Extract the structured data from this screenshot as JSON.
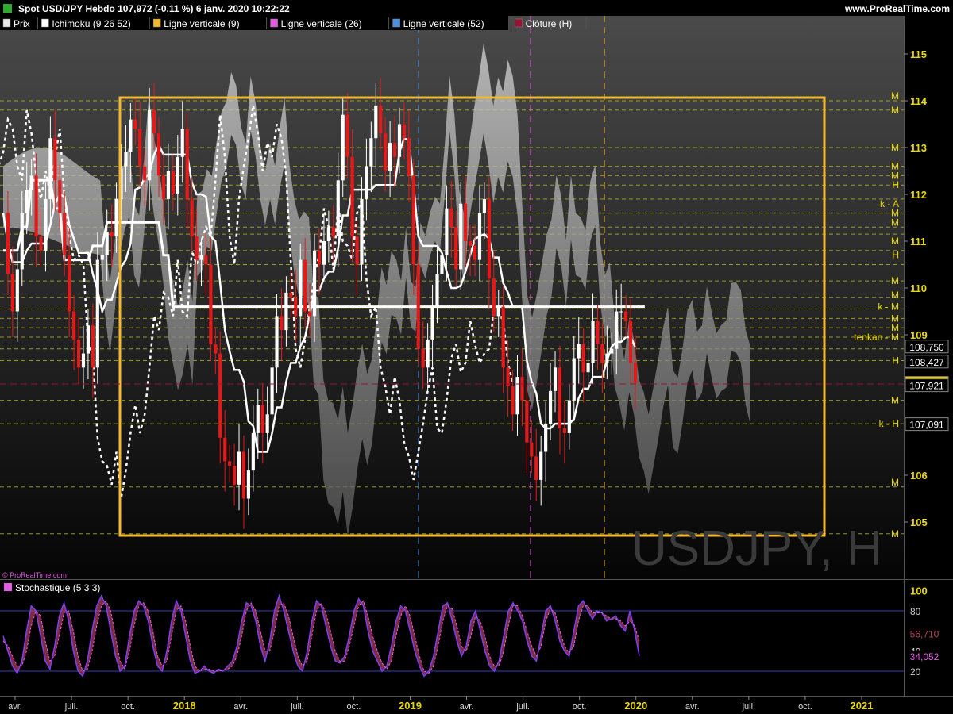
{
  "header": {
    "title": "Spot USD/JPY Hebdo 107,972 (-0,11 %) 6 janv. 2020 10:22:22",
    "site": "www.ProRealTime.com"
  },
  "legend": [
    {
      "label": "Prix",
      "color": "#e8e8e8",
      "icon": "candle-icon"
    },
    {
      "label": "Ichimoku (9 26 52)",
      "color": "#ffffff",
      "icon": "white-square-icon"
    },
    {
      "label": "Ligne verticale (9)",
      "color": "#f5b82e",
      "icon": "yellow-square-icon"
    },
    {
      "label": "Ligne verticale (26)",
      "color": "#e35be0",
      "icon": "magenta-square-icon"
    },
    {
      "label": "Ligne verticale (52)",
      "color": "#4a90e2",
      "icon": "blue-square-icon"
    },
    {
      "label": "Clôture (H)",
      "color": "#9b1030",
      "icon": "crimson-square-icon"
    }
  ],
  "watermark": "USDJPY, H",
  "copyright": "© ProRealTime.com",
  "price_axis": {
    "ticks": [
      "115",
      "114",
      "113",
      "112",
      "111",
      "110",
      "109",
      "108",
      "106",
      "105"
    ],
    "boxes": [
      {
        "label": "108,750",
        "value": 108.75,
        "bg": "#000000",
        "fg": "#ffffff"
      },
      {
        "label": "108,427",
        "value": 108.427,
        "bg": "#000000",
        "fg": "#ffffff"
      },
      {
        "label": "107,972",
        "value": 107.972,
        "bg": "#f5d800",
        "fg": "#000000"
      },
      {
        "label": "107,921",
        "value": 107.921,
        "bg": "#000000",
        "fg": "#ffffff"
      },
      {
        "label": "107,091",
        "value": 107.091,
        "bg": "#000000",
        "fg": "#ffffff"
      }
    ]
  },
  "levels": {
    "values": [
      114.0,
      113.8,
      113.0,
      112.6,
      112.4,
      112.2,
      111.9,
      111.6,
      111.3,
      111.15,
      110.8,
      110.5,
      110.15,
      109.8,
      109.55,
      109.35,
      109.15,
      108.95,
      108.7,
      108.45,
      107.6,
      107.1,
      105.75,
      104.75
    ],
    "markers": [
      {
        "text": "M",
        "value": 114.1
      },
      {
        "text": "M",
        "value": 113.8
      },
      {
        "text": "M",
        "value": 113.0
      },
      {
        "text": "M",
        "value": 112.6
      },
      {
        "text": "M",
        "value": 112.4
      },
      {
        "text": "H",
        "value": 112.2
      },
      {
        "text": "k - A",
        "value": 111.8
      },
      {
        "text": "M",
        "value": 111.6
      },
      {
        "text": "M",
        "value": 111.4
      },
      {
        "text": "M",
        "value": 111.0
      },
      {
        "text": "H",
        "value": 110.7
      },
      {
        "text": "M",
        "value": 110.15
      },
      {
        "text": "M",
        "value": 109.85
      },
      {
        "text": "k - M",
        "value": 109.6
      },
      {
        "text": "M",
        "value": 109.35
      },
      {
        "text": "M",
        "value": 109.15
      },
      {
        "text": "tenkan - M",
        "value": 108.95
      },
      {
        "text": "H",
        "value": 108.45
      },
      {
        "text": "M",
        "value": 107.6
      },
      {
        "text": "k - H",
        "value": 107.1
      },
      {
        "text": "M",
        "value": 105.85
      },
      {
        "text": "M",
        "value": 104.75
      }
    ]
  },
  "time_axis": {
    "labels": [
      {
        "text": "avr.",
        "pos": 0,
        "major": false
      },
      {
        "text": "juil.",
        "pos": 1,
        "major": false
      },
      {
        "text": "oct.",
        "pos": 2,
        "major": false
      },
      {
        "text": "2018",
        "pos": 3,
        "major": true
      },
      {
        "text": "avr.",
        "pos": 4,
        "major": false
      },
      {
        "text": "juil.",
        "pos": 5,
        "major": false
      },
      {
        "text": "oct.",
        "pos": 6,
        "major": false
      },
      {
        "text": "2019",
        "pos": 7,
        "major": true
      },
      {
        "text": "avr.",
        "pos": 8,
        "major": false
      },
      {
        "text": "juil.",
        "pos": 9,
        "major": false
      },
      {
        "text": "oct.",
        "pos": 10,
        "major": false
      },
      {
        "text": "2020",
        "pos": 11,
        "major": true
      },
      {
        "text": "avr.",
        "pos": 12,
        "major": false
      },
      {
        "text": "juil.",
        "pos": 13,
        "major": false
      },
      {
        "text": "oct.",
        "pos": 14,
        "major": false
      },
      {
        "text": "2021",
        "pos": 15,
        "major": true
      }
    ]
  },
  "colors": {
    "background": "#000000",
    "up_candle": "#ffffff",
    "down_candle": "#e81818",
    "level_line": "#b8b820",
    "level_text": "#e8d800",
    "box": "#f5b82e",
    "stoch_k": "#7b3ff5",
    "stoch_d": "#e35be0",
    "stoch_fill": "#b0405a"
  },
  "chart_data": [
    {
      "type": "line",
      "title": "Spot USD/JPY Hebdo",
      "x_unit": "week",
      "ylim": [
        104.0,
        115.6
      ],
      "series": [
        {
          "name": "Prix",
          "values": [
            111.6,
            110.3,
            109.5,
            110.4,
            111.6,
            112.1,
            112.4,
            111.1,
            110.8,
            111.9,
            113.2,
            112.3,
            111.6,
            110.7,
            109.5,
            108.9,
            108.3,
            108.6,
            109.2,
            108.3,
            110.6,
            110.7,
            111.2,
            111.1,
            111.9,
            112.6,
            112.9,
            113.6,
            113.4,
            112.6,
            112.3,
            113.8,
            113.3,
            112.4,
            111.9,
            112.5,
            112.0,
            112.8,
            113.4,
            111.9,
            111.1,
            110.6,
            110.7,
            110.5,
            108.8,
            108.6,
            106.8,
            106.3,
            106.2,
            105.8,
            106.5,
            105.5,
            106.1,
            106.9,
            107.5,
            106.9,
            107.3,
            108.3,
            109.4,
            109.1,
            109.9,
            109.8,
            109.4,
            110.6,
            109.5,
            109.4,
            110.8,
            110.5,
            111.0,
            111.3,
            111.1,
            112.3,
            113.7,
            112.8,
            111.1,
            110.5,
            111.9,
            112.6,
            113.2,
            113.9,
            113.3,
            112.5,
            113.1,
            112.8,
            113.5,
            113.2,
            112.4,
            110.5,
            108.7,
            108.3,
            108.9,
            109.6,
            110.3,
            110.7,
            111.7,
            111.3,
            110.4,
            111.8,
            111.0,
            110.9,
            110.6,
            111.6,
            111.9,
            110.2,
            109.4,
            109.6,
            108.3,
            107.9,
            107.3,
            108.1,
            107.6,
            106.7,
            106.4,
            105.9,
            106.5,
            107.1,
            107.8,
            108.3,
            107.0,
            106.9,
            107.6,
            108.5,
            108.8,
            108.2,
            108.4,
            109.3,
            108.8,
            108.4,
            108.6,
            108.7,
            109.5,
            109.5,
            109.3,
            108.4,
            107.97
          ]
        },
        {
          "name": "Ichimoku (9 26 52)",
          "values": [
            110.8,
            110.8,
            110.8,
            110.8,
            111.3,
            111.3,
            112.3,
            112.3,
            112.3,
            112.3,
            112.3,
            111.7,
            111.7,
            110.6,
            110.6,
            110.6,
            110.6,
            110.6,
            110.6,
            110.9,
            110.9,
            110.9,
            111.4,
            111.4,
            111.4,
            111.4,
            111.4,
            111.4,
            111.4,
            111.4,
            111.4,
            111.4,
            111.4,
            111.4,
            110.7,
            110.7,
            109.6,
            109.6,
            109.6,
            109.6,
            109.6,
            109.6,
            109.6,
            109.6,
            109.6,
            109.6,
            109.6,
            109.6,
            109.6,
            109.6,
            109.6,
            109.6,
            109.6,
            109.6,
            109.6,
            109.6,
            109.6,
            109.6,
            109.6,
            109.6,
            109.6,
            109.6,
            109.6,
            109.6,
            109.6,
            109.6,
            109.6,
            109.6,
            109.6,
            109.6,
            109.6,
            109.6,
            109.6,
            109.6,
            109.6,
            109.6,
            109.6,
            109.6,
            109.6,
            109.6,
            109.6,
            109.6,
            109.6,
            109.6,
            109.6,
            109.6,
            109.6,
            109.6,
            109.6,
            109.6,
            109.6,
            109.6,
            109.6,
            109.6,
            109.6,
            109.6,
            109.6,
            109.6,
            109.6,
            109.6,
            109.6,
            109.6,
            109.6,
            109.6,
            109.6,
            109.6,
            109.6,
            109.6,
            109.6,
            109.6,
            109.6,
            109.6,
            109.6,
            109.6,
            109.6,
            109.6,
            109.6,
            109.6,
            109.6,
            109.6,
            109.6,
            109.6,
            109.6,
            109.6,
            109.6,
            109.6,
            109.6,
            109.6,
            109.6,
            109.6,
            109.6,
            109.6,
            109.6,
            109.6,
            109.6,
            109.6,
            109.6
          ]
        }
      ]
    },
    {
      "type": "line",
      "title": "Stochastique (5 3 3)",
      "ylim": [
        0,
        100
      ],
      "reference_lines": [
        20,
        80
      ],
      "ticks": [
        "100",
        "80",
        "60",
        "40",
        "20"
      ],
      "last_values": [
        {
          "label": "56,710",
          "value": 56.71,
          "color": "#b0405a"
        },
        {
          "label": "34,052",
          "value": 34.052,
          "color": "#e35be0"
        }
      ],
      "series": [
        {
          "name": "%K",
          "values": [
            55,
            40,
            25,
            18,
            30,
            60,
            85,
            80,
            55,
            30,
            22,
            45,
            75,
            88,
            70,
            40,
            20,
            15,
            30,
            60,
            85,
            95,
            85,
            60,
            35,
            20,
            25,
            55,
            80,
            90,
            85,
            70,
            45,
            25,
            20,
            40,
            70,
            90,
            80,
            55,
            30,
            18,
            20,
            25,
            20,
            18,
            22,
            20,
            25,
            30,
            45,
            70,
            88,
            85,
            70,
            45,
            30,
            50,
            80,
            95,
            80,
            60,
            40,
            25,
            20,
            40,
            70,
            90,
            85,
            65,
            45,
            30,
            28,
            35,
            55,
            80,
            92,
            85,
            60,
            40,
            30,
            20,
            25,
            45,
            70,
            85,
            80,
            60,
            40,
            25,
            15,
            20,
            35,
            60,
            85,
            88,
            70,
            50,
            35,
            45,
            70,
            80,
            60,
            40,
            25,
            20,
            30,
            55,
            80,
            88,
            80,
            70,
            50,
            35,
            30,
            55,
            80,
            85,
            70,
            50,
            40,
            35,
            60,
            85,
            90,
            80,
            72,
            80,
            78,
            70,
            72,
            75,
            65,
            60,
            80,
            60,
            35
          ]
        },
        {
          "name": "%D",
          "values": [
            50,
            45,
            35,
            25,
            25,
            40,
            65,
            80,
            75,
            50,
            30,
            35,
            55,
            78,
            80,
            60,
            35,
            20,
            22,
            40,
            65,
            85,
            90,
            80,
            55,
            30,
            22,
            40,
            65,
            85,
            88,
            80,
            60,
            35,
            25,
            30,
            55,
            80,
            85,
            70,
            45,
            25,
            20,
            22,
            22,
            20,
            20,
            21,
            22,
            25,
            35,
            55,
            80,
            88,
            80,
            60,
            40,
            40,
            60,
            85,
            88,
            75,
            55,
            35,
            25,
            30,
            55,
            80,
            88,
            78,
            60,
            40,
            30,
            30,
            45,
            65,
            85,
            90,
            75,
            55,
            40,
            28,
            22,
            30,
            55,
            75,
            85,
            75,
            55,
            35,
            20,
            18,
            25,
            45,
            70,
            85,
            82,
            65,
            45,
            40,
            55,
            75,
            70,
            55,
            35,
            25,
            25,
            40,
            65,
            85,
            85,
            75,
            60,
            45,
            35,
            45,
            70,
            82,
            78,
            60,
            45,
            38,
            45,
            70,
            85,
            85,
            78,
            78,
            78,
            75,
            72,
            72,
            70,
            65,
            70,
            65,
            50
          ]
        }
      ]
    }
  ]
}
